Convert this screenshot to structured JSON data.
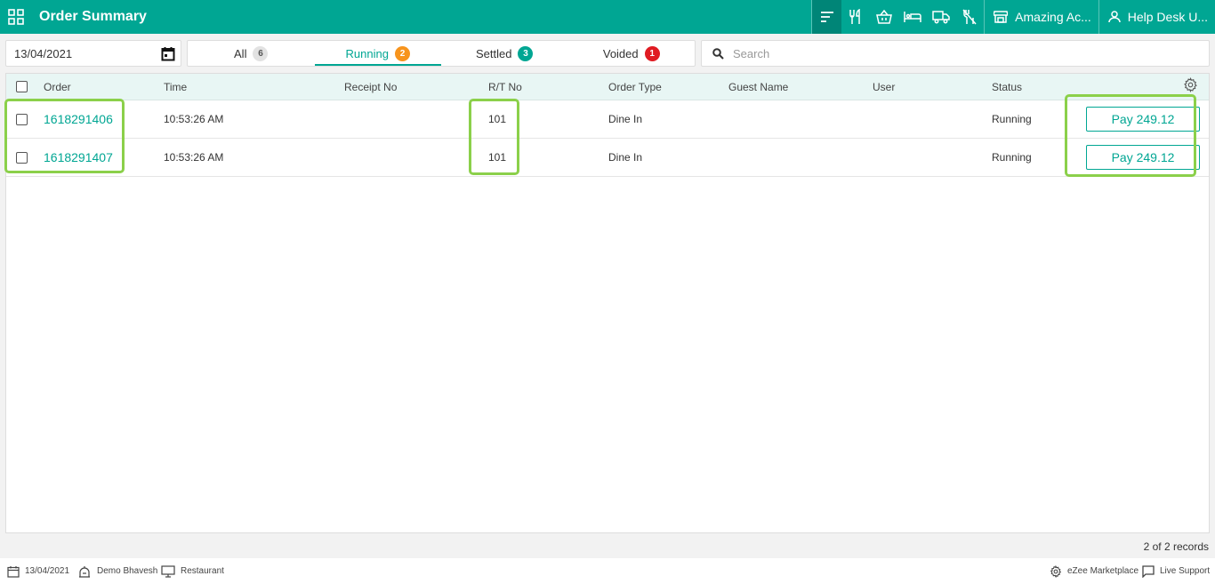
{
  "header": {
    "title": "Order Summary",
    "store_name": "Amazing Ac...",
    "user_name": "Help Desk U..."
  },
  "filters": {
    "date": "13/04/2021",
    "search_placeholder": "Search",
    "tabs": [
      {
        "label": "All",
        "count": "6",
        "color": "grey",
        "active": false
      },
      {
        "label": "Running",
        "count": "2",
        "color": "orange",
        "active": true
      },
      {
        "label": "Settled",
        "count": "3",
        "color": "teal",
        "active": false
      },
      {
        "label": "Voided",
        "count": "1",
        "color": "red",
        "active": false
      }
    ]
  },
  "table": {
    "columns": [
      "Order",
      "Time",
      "Receipt No",
      "R/T No",
      "Order Type",
      "Guest Name",
      "User",
      "Status"
    ],
    "rows": [
      {
        "order": "1618291406",
        "time": "10:53:26 AM",
        "receipt": "",
        "rt": "101",
        "type": "Dine In",
        "guest": "",
        "user": "",
        "status": "Running",
        "pay": "Pay 249.12"
      },
      {
        "order": "1618291407",
        "time": "10:53:26 AM",
        "receipt": "",
        "rt": "101",
        "type": "Dine In",
        "guest": "",
        "user": "",
        "status": "Running",
        "pay": "Pay 249.12"
      }
    ],
    "records": "2 of 2 records"
  },
  "footer": {
    "date": "13/04/2021",
    "user": "Demo Bhavesh",
    "outlet": "Restaurant",
    "marketplace": "eZee Marketplace",
    "support": "Live Support"
  },
  "colors": {
    "brand": "#00a693",
    "brand_dark": "#008577",
    "highlight": "#8bd04a"
  }
}
